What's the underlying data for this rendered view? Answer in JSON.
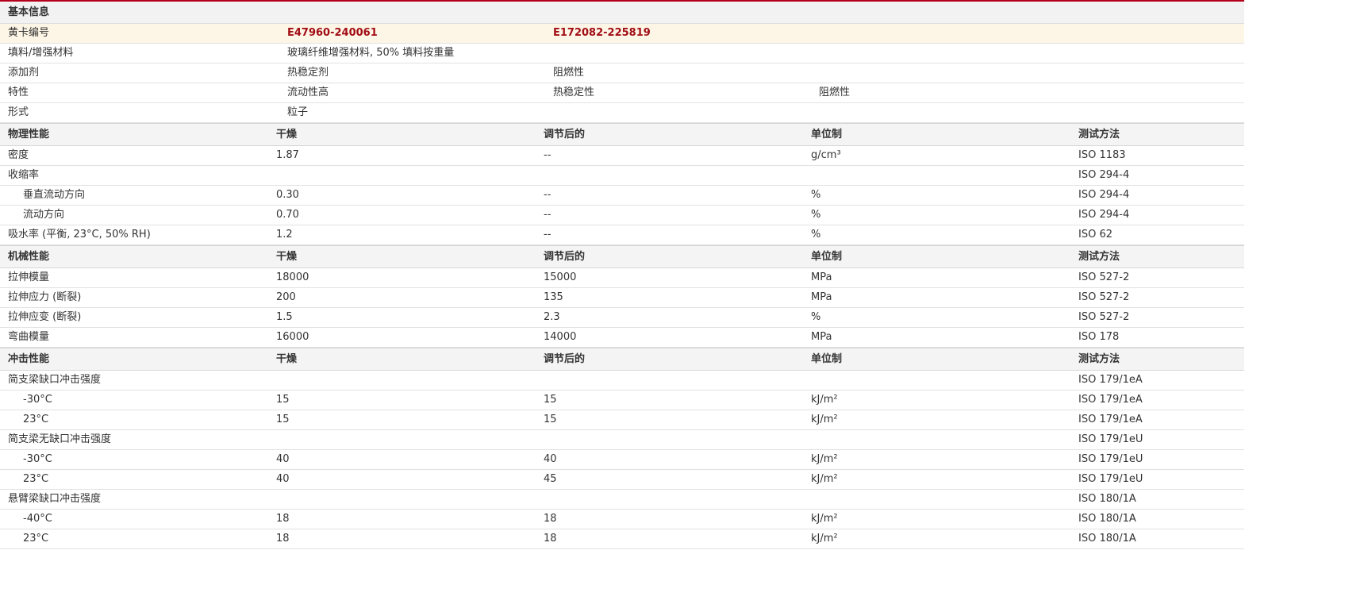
{
  "basic": {
    "title": "基本信息",
    "rows": [
      {
        "label": "黄卡编号",
        "v1": "E47960-240061",
        "v2": "E172082-225819",
        "v3": ""
      },
      {
        "label": "填料/增强材料",
        "v1": "玻璃纤维增强材料, 50% 填料按重量",
        "v2": "",
        "v3": ""
      },
      {
        "label": "添加剂",
        "v1": "热稳定剂",
        "v2": "阻燃性",
        "v3": ""
      },
      {
        "label": "特性",
        "v1": "流动性高",
        "v2": "热稳定性",
        "v3": "阻燃性"
      },
      {
        "label": "形式",
        "v1": "粒子",
        "v2": "",
        "v3": ""
      }
    ]
  },
  "physical": {
    "header": {
      "name": "物理性能",
      "dry": "干燥",
      "cond": "调节后的",
      "unit": "单位制",
      "method": "测试方法"
    },
    "rows": [
      {
        "name": "密度",
        "dry": "1.87",
        "cond": "--",
        "unit": "g/cm³",
        "method": "ISO 1183"
      },
      {
        "name": "收缩率",
        "dry": "",
        "cond": "",
        "unit": "",
        "method": "ISO 294-4"
      },
      {
        "name": "垂直流动方向",
        "dry": "0.30",
        "cond": "--",
        "unit": "%",
        "method": "ISO 294-4"
      },
      {
        "name": "流动方向",
        "dry": "0.70",
        "cond": "--",
        "unit": "%",
        "method": "ISO 294-4"
      },
      {
        "name": "吸水率 (平衡, 23°C, 50% RH)",
        "dry": "1.2",
        "cond": "--",
        "unit": "%",
        "method": "ISO 62"
      }
    ]
  },
  "mechanical": {
    "header": {
      "name": "机械性能",
      "dry": "干燥",
      "cond": "调节后的",
      "unit": "单位制",
      "method": "测试方法"
    },
    "rows": [
      {
        "name": "拉伸模量",
        "dry": "18000",
        "cond": "15000",
        "unit": "MPa",
        "method": "ISO 527-2"
      },
      {
        "name": "拉伸应力 (断裂)",
        "dry": "200",
        "cond": "135",
        "unit": "MPa",
        "method": "ISO 527-2"
      },
      {
        "name": "拉伸应变 (断裂)",
        "dry": "1.5",
        "cond": "2.3",
        "unit": "%",
        "method": "ISO 527-2"
      },
      {
        "name": "弯曲模量",
        "dry": "16000",
        "cond": "14000",
        "unit": "MPa",
        "method": "ISO 178"
      }
    ]
  },
  "impact": {
    "header": {
      "name": "冲击性能",
      "dry": "干燥",
      "cond": "调节后的",
      "unit": "单位制",
      "method": "测试方法"
    },
    "rows": [
      {
        "name": "简支梁缺口冲击强度",
        "dry": "",
        "cond": "",
        "unit": "",
        "method": "ISO 179/1eA"
      },
      {
        "name": "-30°C",
        "dry": "15",
        "cond": "15",
        "unit": "kJ/m²",
        "method": "ISO 179/1eA"
      },
      {
        "name": "23°C",
        "dry": "15",
        "cond": "15",
        "unit": "kJ/m²",
        "method": "ISO 179/1eA"
      },
      {
        "name": "简支梁无缺口冲击强度",
        "dry": "",
        "cond": "",
        "unit": "",
        "method": "ISO 179/1eU"
      },
      {
        "name": "-30°C",
        "dry": "40",
        "cond": "40",
        "unit": "kJ/m²",
        "method": "ISO 179/1eU"
      },
      {
        "name": "23°C",
        "dry": "40",
        "cond": "45",
        "unit": "kJ/m²",
        "method": "ISO 179/1eU"
      },
      {
        "name": "悬臂梁缺口冲击强度",
        "dry": "",
        "cond": "",
        "unit": "",
        "method": "ISO 180/1A"
      },
      {
        "name": "-40°C",
        "dry": "18",
        "cond": "18",
        "unit": "kJ/m²",
        "method": "ISO 180/1A"
      },
      {
        "name": "23°C",
        "dry": "18",
        "cond": "18",
        "unit": "kJ/m²",
        "method": "ISO 180/1A"
      }
    ]
  }
}
